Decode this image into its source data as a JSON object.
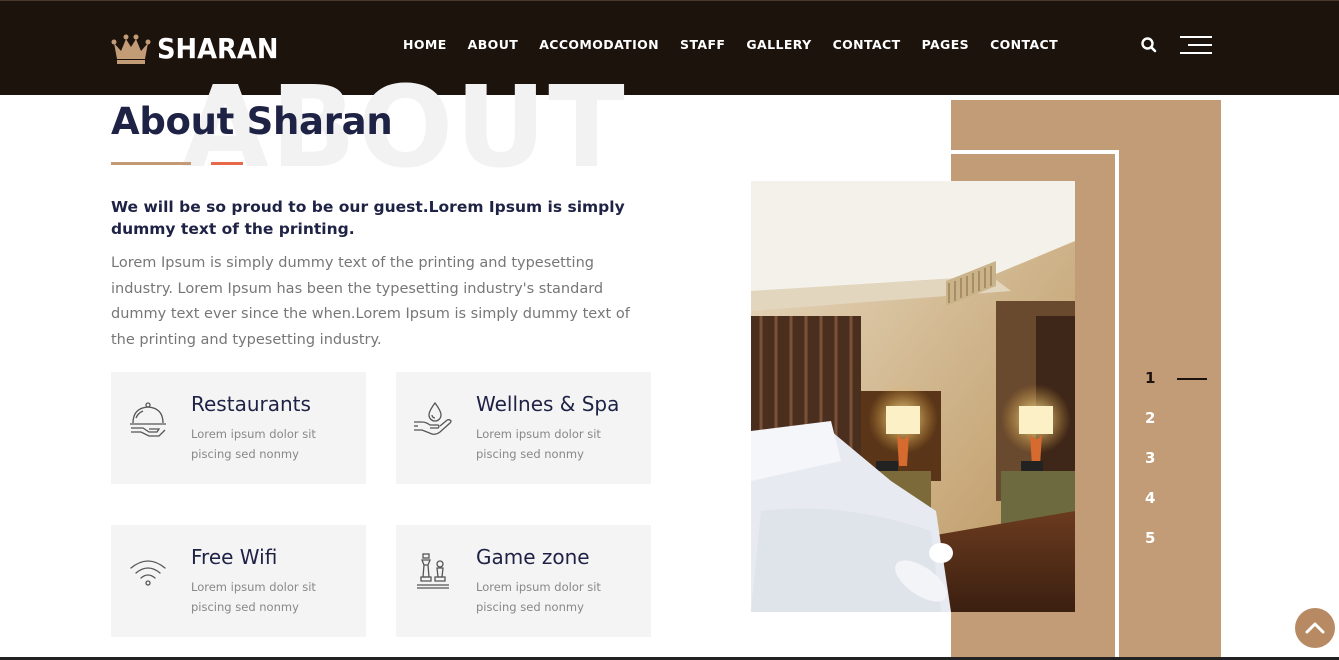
{
  "header": {
    "logo_text": "SHARAN",
    "nav": [
      {
        "label": "HOME"
      },
      {
        "label": "ABOUT"
      },
      {
        "label": "ACCOMODATION"
      },
      {
        "label": "STAFF"
      },
      {
        "label": "GALLERY"
      },
      {
        "label": "CONTACT"
      },
      {
        "label": "PAGES"
      },
      {
        "label": "CONTACT"
      }
    ],
    "icons": [
      "crown-icon",
      "search-icon",
      "hamburger-menu-icon"
    ]
  },
  "about": {
    "watermark": "ABOUT",
    "title": "About Sharan",
    "lead": "We will be so proud to be our guest.Lorem Ipsum is simply dummy text of the printing.",
    "body": "Lorem Ipsum is simply dummy text of the printing and typesetting industry. Lorem Ipsum has been the typesetting industry's standard dummy text ever since the when.Lorem Ipsum is simply dummy text of the printing and typesetting industry."
  },
  "features": [
    {
      "title": "Restaurants",
      "text": "Lorem ipsum dolor sit piscing sed nonmy",
      "icon": "cloche-icon"
    },
    {
      "title": "Wellnes & Spa",
      "text": "Lorem ipsum dolor sit piscing sed nonmy",
      "icon": "spa-drop-hand-icon"
    },
    {
      "title": "Free Wifi",
      "text": "Lorem ipsum dolor sit piscing sed nonmy",
      "icon": "wifi-icon"
    },
    {
      "title": "Game zone",
      "text": "Lorem ipsum dolor sit piscing sed nonmy",
      "icon": "chess-icon"
    }
  ],
  "slider": {
    "numbers": [
      "1",
      "2",
      "3",
      "4",
      "5"
    ],
    "active_index": 0
  },
  "colors": {
    "header_bg": "#1c130d",
    "accent_tan": "#c29b77",
    "accent_orange": "#e8694a",
    "title_navy": "#1e2245",
    "card_bg": "#f4f4f4"
  }
}
